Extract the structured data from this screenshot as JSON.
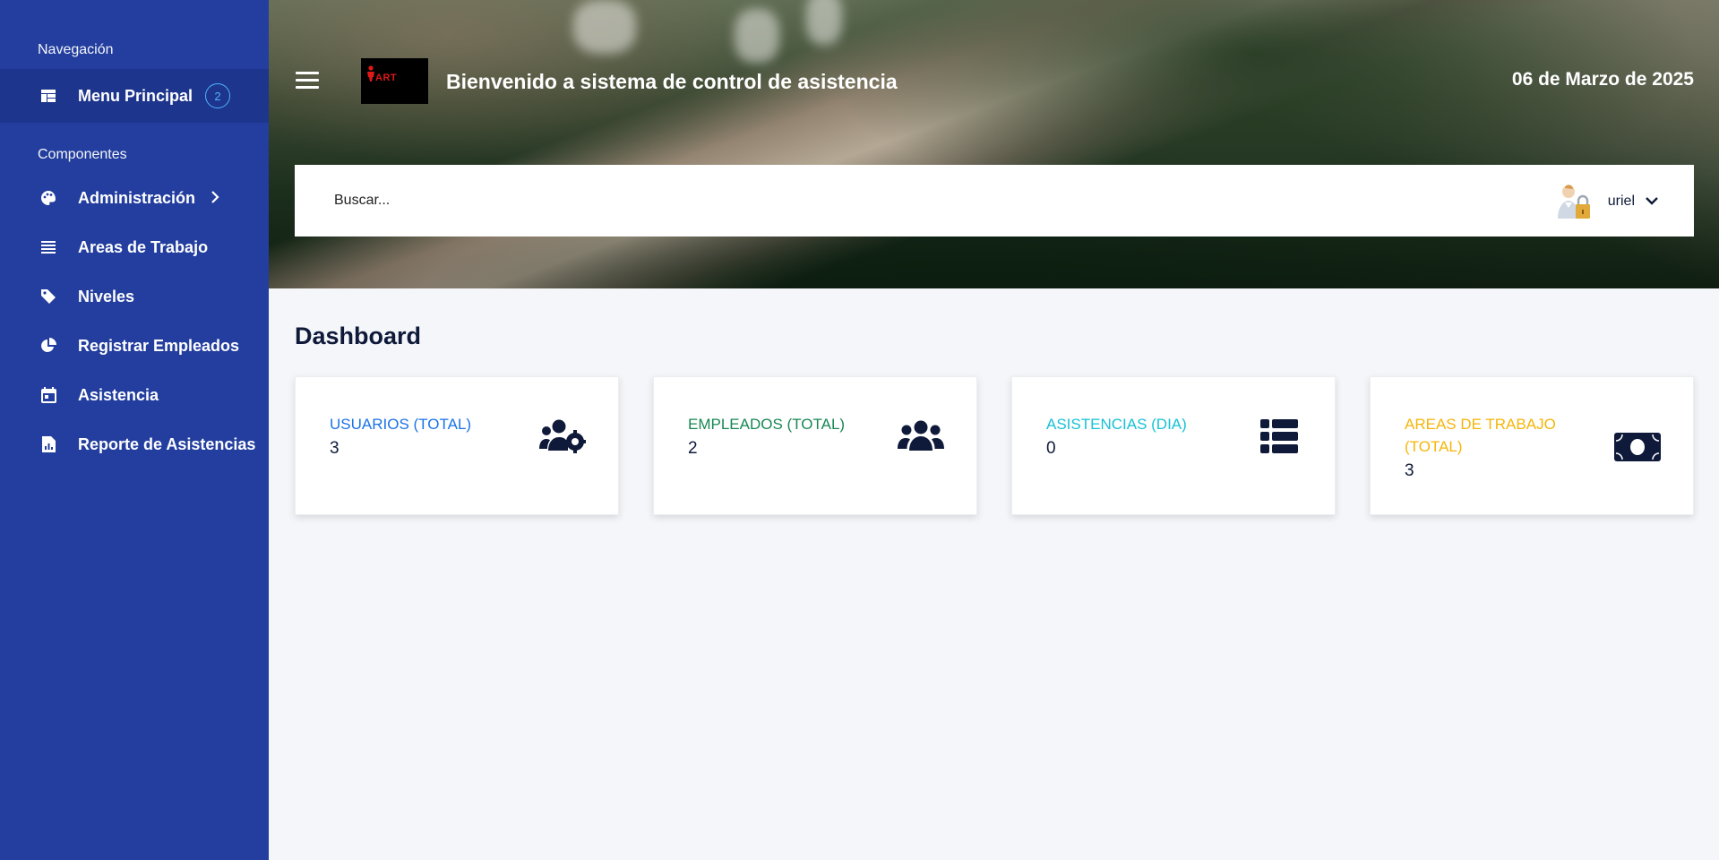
{
  "sidebar": {
    "nav_heading": "Navegación",
    "main_menu": {
      "label": "Menu Principal",
      "badge": "2",
      "icon": "dashboard-icon"
    },
    "components_heading": "Componentes",
    "items": [
      {
        "label": "Administración",
        "icon": "palette-icon",
        "has_submenu": true
      },
      {
        "label": "Areas de Trabajo",
        "icon": "list-icon"
      },
      {
        "label": "Niveles",
        "icon": "tag-icon"
      },
      {
        "label": "Registrar Empleados",
        "icon": "pie-chart-icon"
      },
      {
        "label": "Asistencia",
        "icon": "calendar-icon"
      },
      {
        "label": "Reporte de Asistencias",
        "icon": "report-icon"
      }
    ],
    "bg_color": "#233e9e"
  },
  "header": {
    "title": "Bienvenido a sistema de control de asistencia",
    "date": "06 de Marzo de 2025",
    "logo_text": "ART"
  },
  "search": {
    "placeholder": "Buscar..."
  },
  "user": {
    "name": "uriel"
  },
  "main": {
    "title": "Dashboard",
    "cards": [
      {
        "label": "USUARIOS (TOTAL)",
        "value": "3",
        "color": "#1a73e8",
        "icon": "users-cog-icon"
      },
      {
        "label": "EMPLEADOS (TOTAL)",
        "value": "2",
        "color": "#198754",
        "icon": "users-icon"
      },
      {
        "label": "ASISTENCIAS (DIA)",
        "value": "0",
        "color": "#17c1d6",
        "icon": "table-list-icon"
      },
      {
        "label": "AREAS DE TRABAJO (TOTAL)",
        "value": "3",
        "color": "#f5b50a",
        "icon": "money-bill-icon"
      }
    ]
  }
}
